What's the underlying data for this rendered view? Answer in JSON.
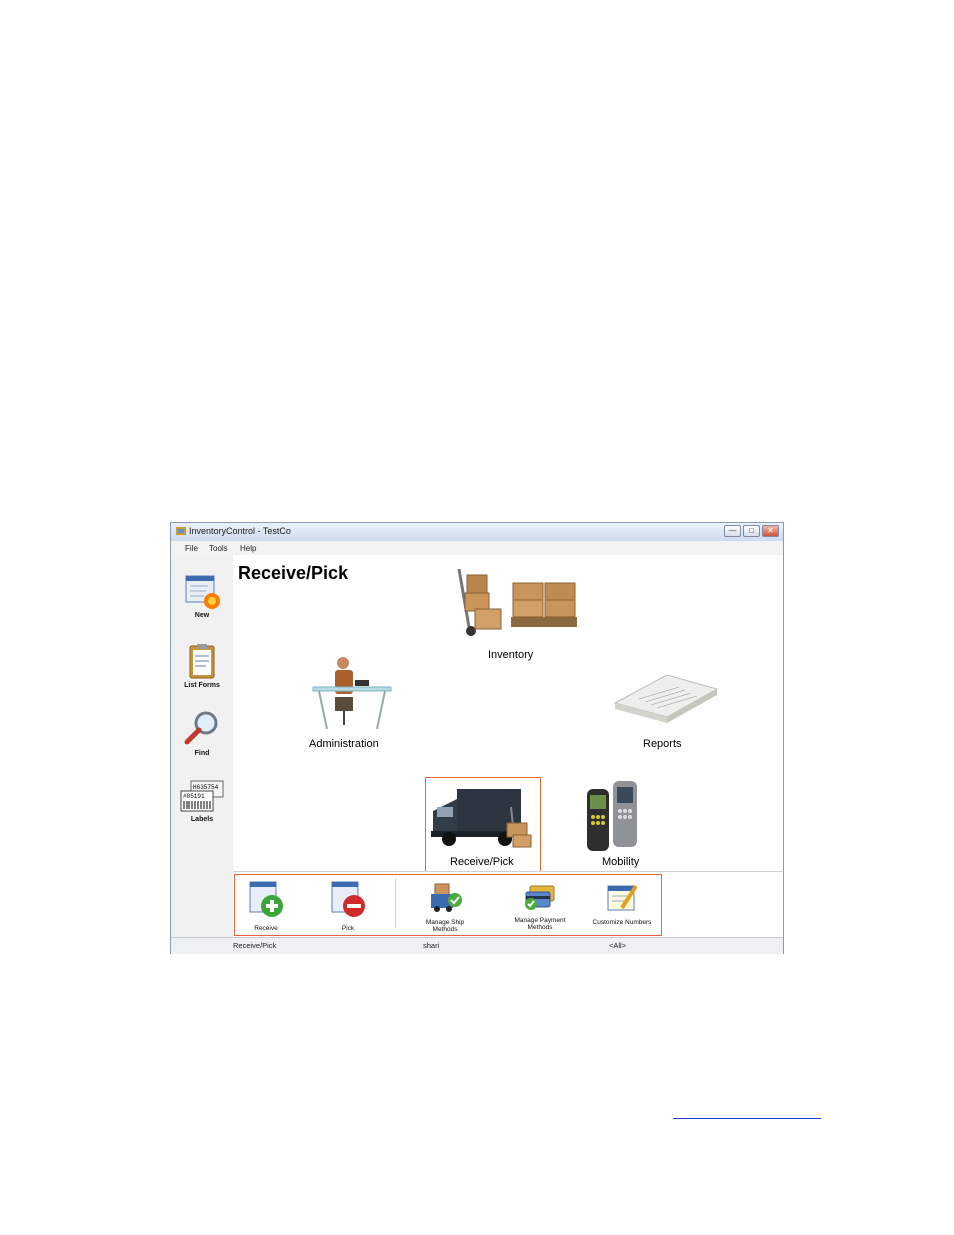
{
  "window": {
    "title": "InventoryControl - TestCo",
    "buttons": {
      "minimize": "—",
      "maximize": "□",
      "close": "✕"
    }
  },
  "menu": {
    "items": [
      "File",
      "Tools",
      "Help"
    ]
  },
  "sidebar": {
    "items": [
      {
        "label": "New",
        "icon": "new-form-icon"
      },
      {
        "label": "List Forms",
        "icon": "clipboard-icon"
      },
      {
        "label": "Find",
        "icon": "magnifier-icon"
      },
      {
        "label": "Labels",
        "icon": "barcode-labels-icon"
      }
    ],
    "label_text": {
      "labels_barcode_1": "H635754",
      "labels_barcode_2": "#05191"
    }
  },
  "main": {
    "title": "Receive/Pick",
    "modules": [
      {
        "label": "Inventory",
        "icon": "boxes-handtruck-icon"
      },
      {
        "label": "Administration",
        "icon": "desk-worker-icon"
      },
      {
        "label": "Reports",
        "icon": "paper-stack-icon"
      },
      {
        "label": "Receive/Pick",
        "icon": "delivery-truck-icon",
        "selected": true
      },
      {
        "label": "Mobility",
        "icon": "handheld-scanner-icon"
      }
    ]
  },
  "tasks": {
    "items": [
      {
        "label": "Receive",
        "icon": "receive-plus-icon"
      },
      {
        "label": "Pick",
        "icon": "pick-minus-icon"
      },
      {
        "label": "Manage Ship Methods",
        "line1": "Manage Ship",
        "line2": "Methods",
        "icon": "ship-methods-icon"
      },
      {
        "label": "Manage Payment Methods",
        "line1": "Manage Payment",
        "line2": "Methods",
        "icon": "payment-methods-icon"
      },
      {
        "label": "Customize Numbers",
        "icon": "customize-numbers-icon"
      }
    ]
  },
  "status": {
    "module": "Receive/Pick",
    "user": "shari",
    "filter": "<All>"
  },
  "colors": {
    "highlight": "#e8643c",
    "link": "#1f3fd0"
  }
}
